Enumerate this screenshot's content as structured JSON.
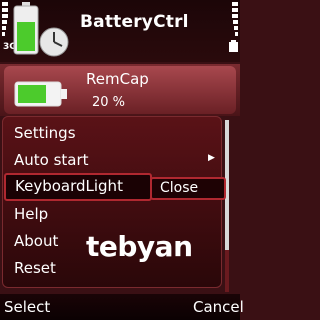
{
  "status": {
    "network": "3G"
  },
  "app": {
    "title": "BatteryCtrl"
  },
  "info": {
    "label": "RemCap",
    "value": "20 %"
  },
  "menu": {
    "items": [
      "Settings",
      "Auto start",
      "KeyboardLight",
      "Help",
      "About",
      "Reset"
    ],
    "selected_index": 2,
    "popup_option": "Close"
  },
  "watermark": "tebyan",
  "softkeys": {
    "left": "Select",
    "right": "Cancel"
  },
  "colors": {
    "accent": "#b02830",
    "battery_green": "#4ccb2c"
  },
  "icons": [
    "battery-clock-icon",
    "signal-bars-icon",
    "battery-level-icon",
    "battery-icon",
    "chevron-right-icon",
    "scrollbar"
  ]
}
